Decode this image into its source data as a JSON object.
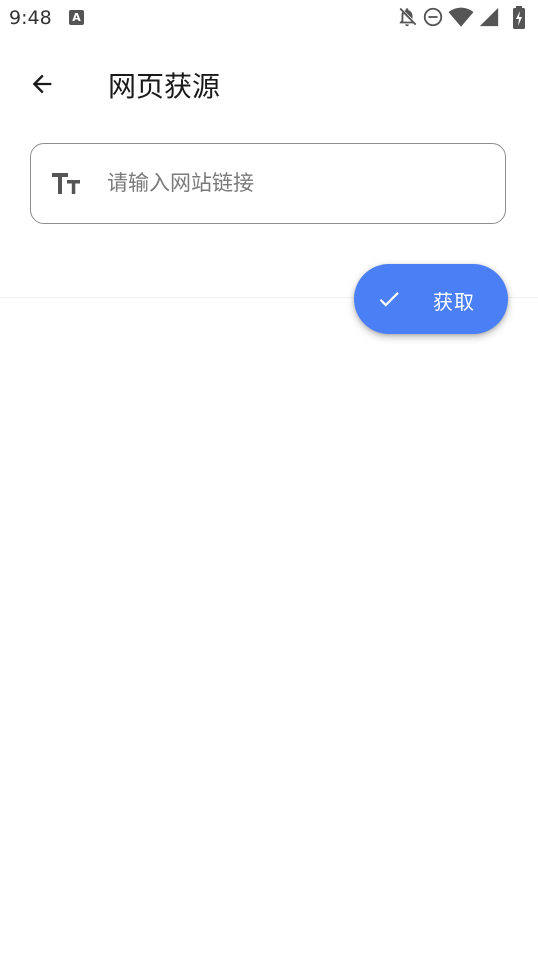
{
  "status_bar": {
    "time": "9:48",
    "notification_icon": "app-a-icon",
    "icons": [
      "bell-off-icon",
      "do-not-disturb-icon",
      "wifi-icon",
      "cellular-signal-icon",
      "battery-charging-icon"
    ]
  },
  "app_bar": {
    "back_icon": "arrow-left-icon",
    "title": "网页获源"
  },
  "url_field": {
    "icon": "text-format-icon",
    "placeholder": "请输入网站链接",
    "value": ""
  },
  "fab": {
    "icon": "check-icon",
    "label": "获取",
    "color": "#4a7ff5"
  }
}
